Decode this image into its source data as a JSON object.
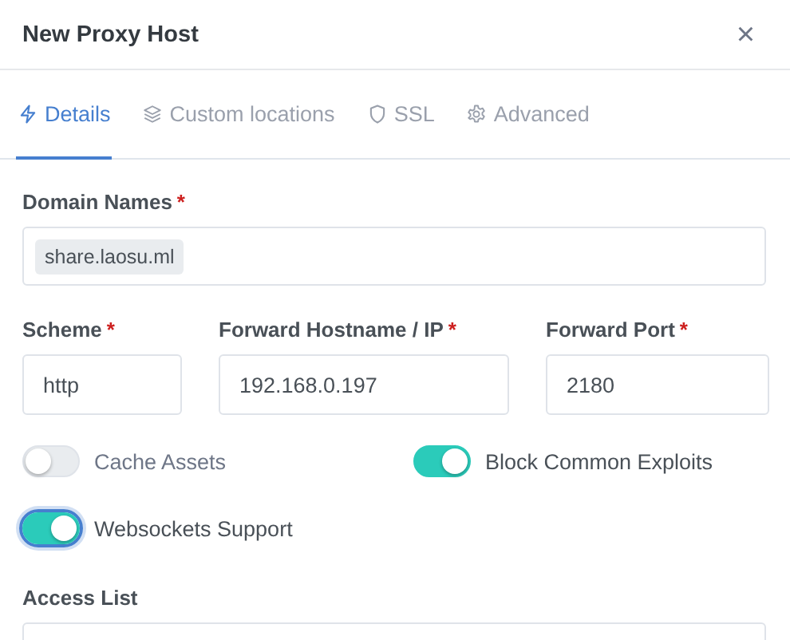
{
  "dialog": {
    "title": "New Proxy Host",
    "close": "×"
  },
  "tabs": [
    {
      "label": "Details",
      "selected": true
    },
    {
      "label": "Custom locations",
      "selected": false
    },
    {
      "label": "SSL",
      "selected": false
    },
    {
      "label": "Advanced",
      "selected": false
    }
  ],
  "domain_names": {
    "label": "Domain Names",
    "required_mark": "*",
    "tags": [
      "share.laosu.ml"
    ]
  },
  "forward_fields": [
    {
      "label": "Scheme",
      "required_mark": "*",
      "value": "http"
    },
    {
      "label": "Forward Hostname / IP",
      "required_mark": "*",
      "value": "192.168.0.197"
    },
    {
      "label": "Forward Port",
      "required_mark": "*",
      "value": "2180"
    }
  ],
  "toggles": [
    {
      "label": "Cache Assets",
      "on": false,
      "focused": false
    },
    {
      "label": "Block Common Exploits",
      "on": true,
      "focused": false
    },
    {
      "label": "Websockets Support",
      "on": true,
      "focused": true
    }
  ],
  "access_list": {
    "label": "Access List"
  }
}
